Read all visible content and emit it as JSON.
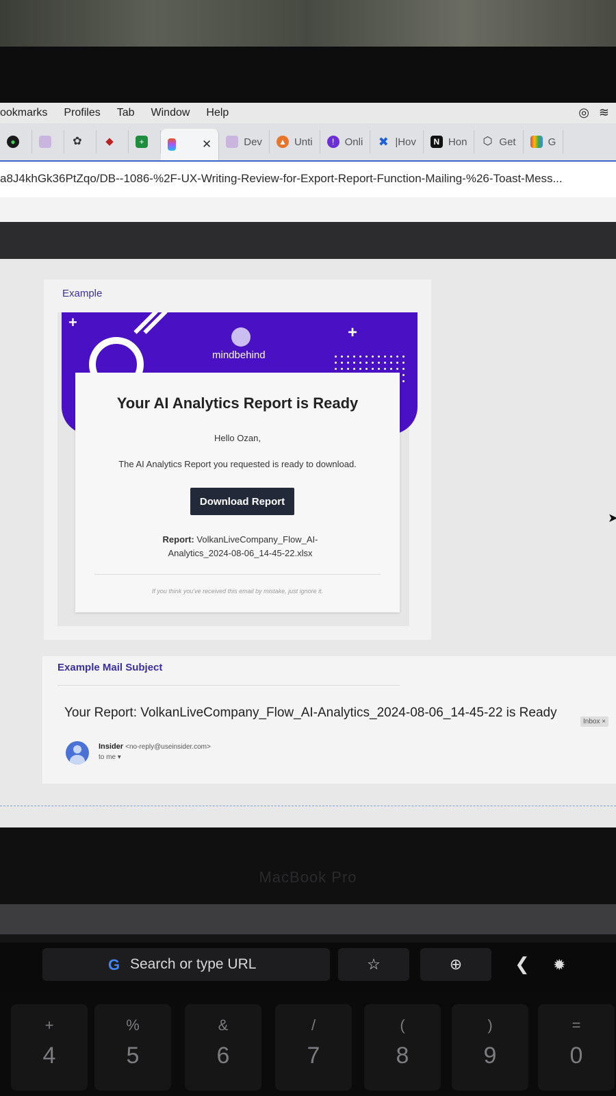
{
  "menubar": {
    "items": [
      "ookmarks",
      "Profiles",
      "Tab",
      "Window",
      "Help"
    ]
  },
  "tabs": [
    {
      "label": "",
      "icon": "leaf-icon"
    },
    {
      "label": "",
      "icon": "app-icon"
    },
    {
      "label": "",
      "icon": "openai-icon"
    },
    {
      "label": "",
      "icon": "bird-icon"
    },
    {
      "label": "",
      "icon": "sheets-icon"
    },
    {
      "label": "",
      "icon": "figma-icon",
      "active": true
    },
    {
      "label": "Dev",
      "icon": "app-icon"
    },
    {
      "label": "Unti",
      "icon": "orange-icon"
    },
    {
      "label": "Onli",
      "icon": "purple-icon"
    },
    {
      "label": "|Hov",
      "icon": "confluence-icon"
    },
    {
      "label": "Hon",
      "icon": "notion-icon"
    },
    {
      "label": "Get",
      "icon": "openai-icon"
    },
    {
      "label": "G",
      "icon": "google-icon"
    }
  ],
  "url": "a8J4khGk36PtZqo/DB--1086-%2F-UX-Writing-Review-for-Export-Report-Function-Mailing-%26-Toast-Mess...",
  "frame1": {
    "label": "Example",
    "brand": "mindbehind",
    "title": "Your AI Analytics Report is Ready",
    "greeting": "Hello Ozan,",
    "message": "The AI Analytics Report you requested is ready to download.",
    "button": "Download Report",
    "report_label": "Report:",
    "report_file": "VolkanLiveCompany_Flow_AI-Analytics_2024-08-06_14-45-22.xlsx",
    "footer": "If you think you've received this email by mistake, just ignore it."
  },
  "frame2": {
    "label": "Example Mail Subject",
    "subject": "Your Report: VolkanLiveCompany_Flow_AI-Analytics_2024-08-06_14-45-22 is Ready",
    "badge": "Inbox ×",
    "sender_name": "Insider",
    "sender_email": "<no-reply@useinsider.com>",
    "to": "to me ▾"
  },
  "device_label": "MacBook Pro",
  "touchbar": {
    "search_g": "G",
    "search_text": "Search or type URL"
  },
  "keys": [
    {
      "shift": "+",
      "main": "4"
    },
    {
      "shift": "%",
      "main": "5"
    },
    {
      "shift": "&",
      "main": "6"
    },
    {
      "shift": "/",
      "main": "7"
    },
    {
      "shift": "(",
      "main": "8"
    },
    {
      "shift": ")",
      "main": "9"
    },
    {
      "shift": "=",
      "main": "0"
    }
  ],
  "colors": {
    "brand_purple": "#4a10c4",
    "button_dark": "#222a3a",
    "label_purple": "#3a2fa0"
  }
}
